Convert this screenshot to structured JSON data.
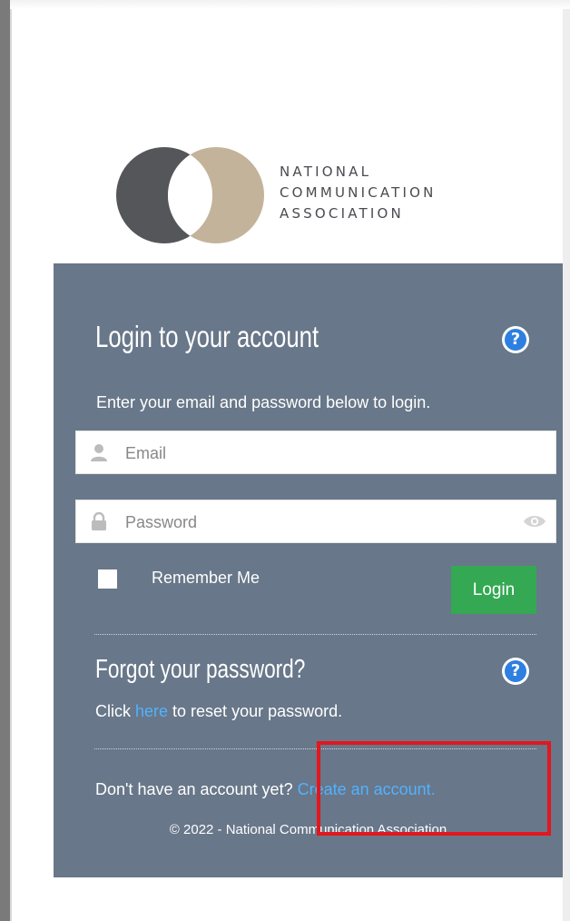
{
  "logo": {
    "org_line1": "NATIONAL",
    "org_line2": "COMMUNICATION",
    "org_line3": "ASSOCIATION",
    "colors": {
      "dark": "#55565a",
      "tan": "#c3b39b"
    }
  },
  "login": {
    "title": "Login to your account",
    "help_icon": "question-circle-icon",
    "instructions": "Enter your email and password below to login.",
    "email_placeholder": "Email",
    "password_placeholder": "Password",
    "remember_label": "Remember Me",
    "login_button": "Login"
  },
  "forgot": {
    "title": "Forgot your password?",
    "prefix": "Click ",
    "link": "here",
    "suffix": " to reset your password."
  },
  "signup": {
    "prompt": "Don't have an account yet? ",
    "link": "Create an account."
  },
  "footer": {
    "copyright": "© 2022 - National Communication Association"
  },
  "colors": {
    "panel": "#687789",
    "accent_green": "#34a853",
    "link": "#52b2ff",
    "help_blue": "#2e7fe0",
    "highlight": "#e3161e"
  }
}
